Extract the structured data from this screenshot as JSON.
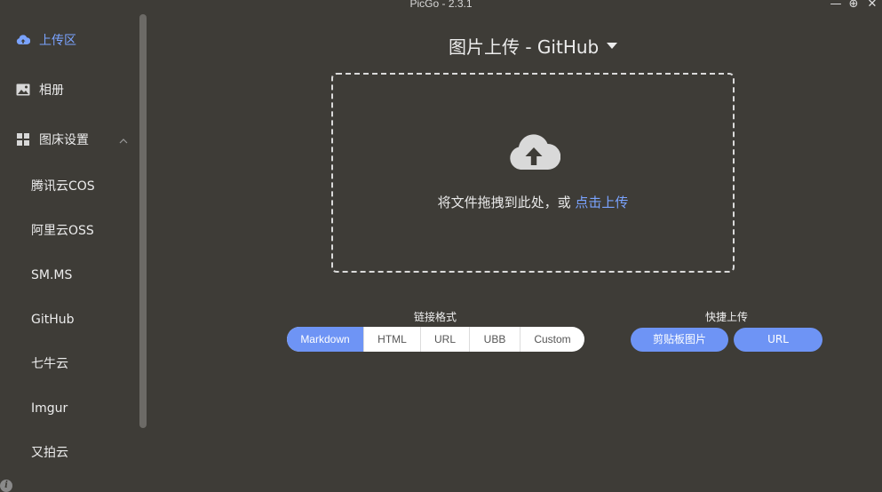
{
  "window": {
    "title": "PicGo - 2.3.1",
    "min_glyph": "—",
    "max_glyph": "⊕",
    "close_glyph": "✕"
  },
  "sidebar": {
    "upload_label": "上传区",
    "album_label": "相册",
    "settings_label": "图床设置",
    "hosts": [
      "腾讯云COS",
      "阿里云OSS",
      "SM.MS",
      "GitHub",
      "七牛云",
      "Imgur",
      "又拍云"
    ],
    "info_glyph": "i"
  },
  "main": {
    "title": "图片上传 - GitHub",
    "drop_text": "将文件拖拽到此处，或 ",
    "drop_link": "点击上传",
    "link_format_label": "链接格式",
    "formats": [
      "Markdown",
      "HTML",
      "URL",
      "UBB",
      "Custom"
    ],
    "active_format": "Markdown",
    "quick_upload_label": "快捷上传",
    "clipboard_btn": "剪贴板图片",
    "url_btn": "URL"
  },
  "colors": {
    "background": "#3e3c37",
    "accent": "#6e94f5",
    "active_text": "#7aa3ff"
  }
}
